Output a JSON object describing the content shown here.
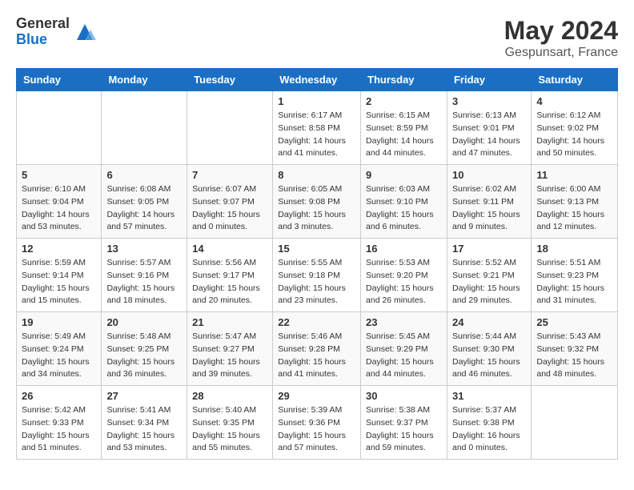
{
  "header": {
    "logo": {
      "general": "General",
      "blue": "Blue"
    },
    "title": "May 2024",
    "location": "Gespunsart, France"
  },
  "calendar": {
    "days_of_week": [
      "Sunday",
      "Monday",
      "Tuesday",
      "Wednesday",
      "Thursday",
      "Friday",
      "Saturday"
    ],
    "weeks": [
      [
        {
          "day": "",
          "info": ""
        },
        {
          "day": "",
          "info": ""
        },
        {
          "day": "",
          "info": ""
        },
        {
          "day": "1",
          "info": "Sunrise: 6:17 AM\nSunset: 8:58 PM\nDaylight: 14 hours\nand 41 minutes."
        },
        {
          "day": "2",
          "info": "Sunrise: 6:15 AM\nSunset: 8:59 PM\nDaylight: 14 hours\nand 44 minutes."
        },
        {
          "day": "3",
          "info": "Sunrise: 6:13 AM\nSunset: 9:01 PM\nDaylight: 14 hours\nand 47 minutes."
        },
        {
          "day": "4",
          "info": "Sunrise: 6:12 AM\nSunset: 9:02 PM\nDaylight: 14 hours\nand 50 minutes."
        }
      ],
      [
        {
          "day": "5",
          "info": "Sunrise: 6:10 AM\nSunset: 9:04 PM\nDaylight: 14 hours\nand 53 minutes."
        },
        {
          "day": "6",
          "info": "Sunrise: 6:08 AM\nSunset: 9:05 PM\nDaylight: 14 hours\nand 57 minutes."
        },
        {
          "day": "7",
          "info": "Sunrise: 6:07 AM\nSunset: 9:07 PM\nDaylight: 15 hours\nand 0 minutes."
        },
        {
          "day": "8",
          "info": "Sunrise: 6:05 AM\nSunset: 9:08 PM\nDaylight: 15 hours\nand 3 minutes."
        },
        {
          "day": "9",
          "info": "Sunrise: 6:03 AM\nSunset: 9:10 PM\nDaylight: 15 hours\nand 6 minutes."
        },
        {
          "day": "10",
          "info": "Sunrise: 6:02 AM\nSunset: 9:11 PM\nDaylight: 15 hours\nand 9 minutes."
        },
        {
          "day": "11",
          "info": "Sunrise: 6:00 AM\nSunset: 9:13 PM\nDaylight: 15 hours\nand 12 minutes."
        }
      ],
      [
        {
          "day": "12",
          "info": "Sunrise: 5:59 AM\nSunset: 9:14 PM\nDaylight: 15 hours\nand 15 minutes."
        },
        {
          "day": "13",
          "info": "Sunrise: 5:57 AM\nSunset: 9:16 PM\nDaylight: 15 hours\nand 18 minutes."
        },
        {
          "day": "14",
          "info": "Sunrise: 5:56 AM\nSunset: 9:17 PM\nDaylight: 15 hours\nand 20 minutes."
        },
        {
          "day": "15",
          "info": "Sunrise: 5:55 AM\nSunset: 9:18 PM\nDaylight: 15 hours\nand 23 minutes."
        },
        {
          "day": "16",
          "info": "Sunrise: 5:53 AM\nSunset: 9:20 PM\nDaylight: 15 hours\nand 26 minutes."
        },
        {
          "day": "17",
          "info": "Sunrise: 5:52 AM\nSunset: 9:21 PM\nDaylight: 15 hours\nand 29 minutes."
        },
        {
          "day": "18",
          "info": "Sunrise: 5:51 AM\nSunset: 9:23 PM\nDaylight: 15 hours\nand 31 minutes."
        }
      ],
      [
        {
          "day": "19",
          "info": "Sunrise: 5:49 AM\nSunset: 9:24 PM\nDaylight: 15 hours\nand 34 minutes."
        },
        {
          "day": "20",
          "info": "Sunrise: 5:48 AM\nSunset: 9:25 PM\nDaylight: 15 hours\nand 36 minutes."
        },
        {
          "day": "21",
          "info": "Sunrise: 5:47 AM\nSunset: 9:27 PM\nDaylight: 15 hours\nand 39 minutes."
        },
        {
          "day": "22",
          "info": "Sunrise: 5:46 AM\nSunset: 9:28 PM\nDaylight: 15 hours\nand 41 minutes."
        },
        {
          "day": "23",
          "info": "Sunrise: 5:45 AM\nSunset: 9:29 PM\nDaylight: 15 hours\nand 44 minutes."
        },
        {
          "day": "24",
          "info": "Sunrise: 5:44 AM\nSunset: 9:30 PM\nDaylight: 15 hours\nand 46 minutes."
        },
        {
          "day": "25",
          "info": "Sunrise: 5:43 AM\nSunset: 9:32 PM\nDaylight: 15 hours\nand 48 minutes."
        }
      ],
      [
        {
          "day": "26",
          "info": "Sunrise: 5:42 AM\nSunset: 9:33 PM\nDaylight: 15 hours\nand 51 minutes."
        },
        {
          "day": "27",
          "info": "Sunrise: 5:41 AM\nSunset: 9:34 PM\nDaylight: 15 hours\nand 53 minutes."
        },
        {
          "day": "28",
          "info": "Sunrise: 5:40 AM\nSunset: 9:35 PM\nDaylight: 15 hours\nand 55 minutes."
        },
        {
          "day": "29",
          "info": "Sunrise: 5:39 AM\nSunset: 9:36 PM\nDaylight: 15 hours\nand 57 minutes."
        },
        {
          "day": "30",
          "info": "Sunrise: 5:38 AM\nSunset: 9:37 PM\nDaylight: 15 hours\nand 59 minutes."
        },
        {
          "day": "31",
          "info": "Sunrise: 5:37 AM\nSunset: 9:38 PM\nDaylight: 16 hours\nand 0 minutes."
        },
        {
          "day": "",
          "info": ""
        }
      ]
    ]
  }
}
